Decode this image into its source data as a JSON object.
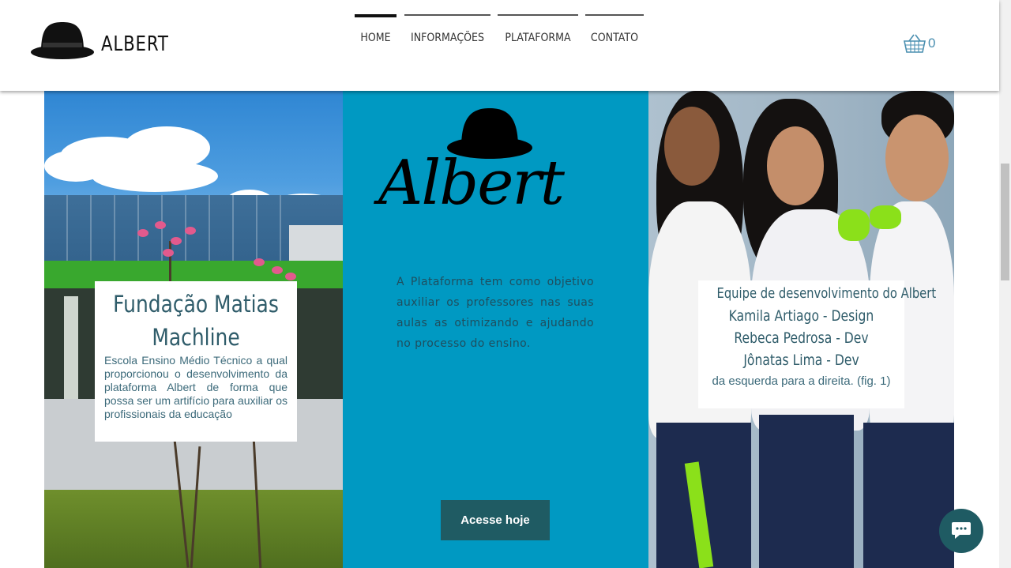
{
  "header": {
    "brand": "ALBERT",
    "nav": [
      {
        "label": "HOME",
        "active": true
      },
      {
        "label": "INFORMAÇÕES",
        "active": false
      },
      {
        "label": "PLATAFORMA",
        "active": false
      },
      {
        "label": "CONTATO",
        "active": false
      }
    ],
    "cart_count": "0"
  },
  "left_card": {
    "title_line1": "Fundação Matias",
    "title_line2": "Machline",
    "text": "Escola Ensino Médio Técnico a qual proporcionou o desenvolvimento da plataforma Albert de forma que possa ser um artifício para auxiliar os profissionais da educação"
  },
  "middle": {
    "script_logo": "Albert",
    "description": "A Plataforma tem como objetivo auxiliar os professores nas suas aulas as otimizando e ajudando no processo do ensino.",
    "cta_label": "Acesse hoje"
  },
  "right_card": {
    "title": "Equipe de desenvolvimento do Albert",
    "member1": "Kamila Artiago - Design",
    "member2": "Rebeca Pedrosa - Dev",
    "member3": "Jônatas Lima - Dev",
    "caption": "da esquerda para a direita. (fig. 1)"
  },
  "icons": {
    "logo": "bowler-hat-icon",
    "cart": "shopping-basket-icon",
    "chat": "chat-bubble-icon"
  },
  "colors": {
    "accent_blue": "#0099c2",
    "button_dark_teal": "#1f5b63",
    "text_teal": "#2f5c6a"
  }
}
